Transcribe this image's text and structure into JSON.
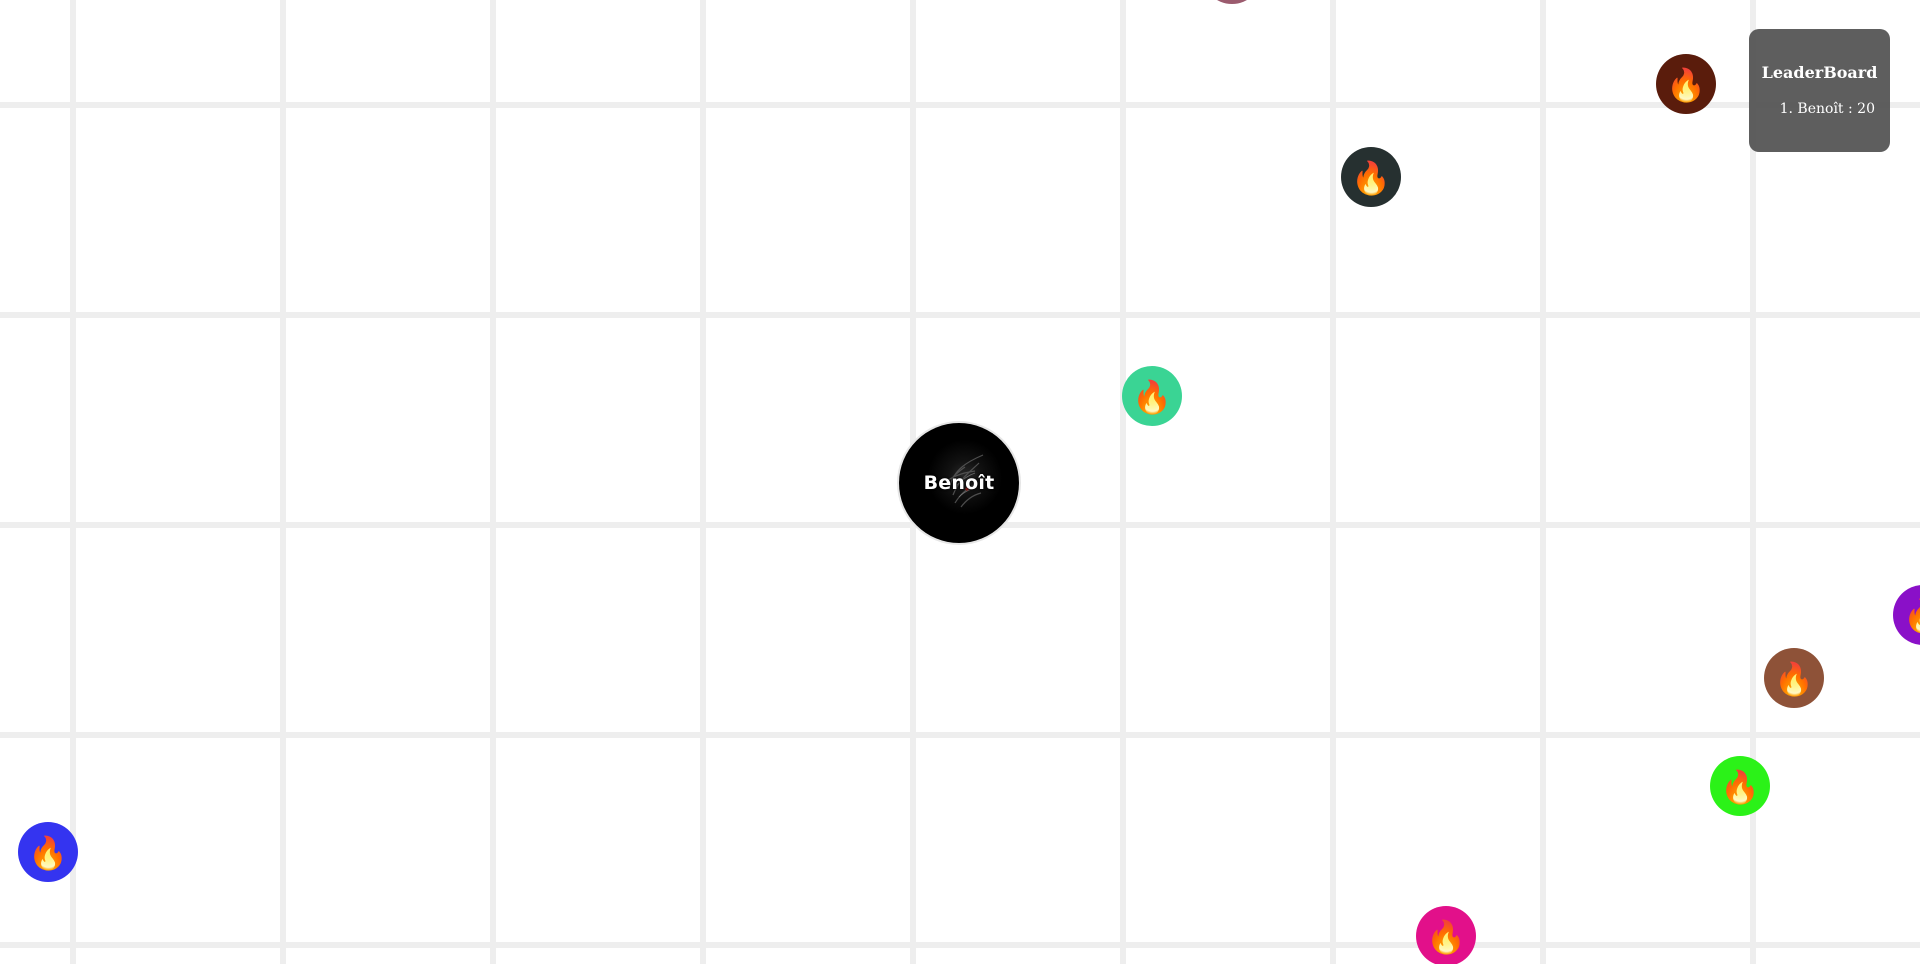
{
  "leaderboard": {
    "title": "LeaderBoard",
    "entries": [
      {
        "rank": "1.",
        "name": "Benoît",
        "separator": ":",
        "score": "20"
      }
    ]
  },
  "player": {
    "name": "Benoît",
    "color": "#000000"
  },
  "food_icon": "fire-emoji",
  "food_glyph": "🔥",
  "food_colors": {
    "top_partial": "#9b5b6e",
    "dark_red": "#5a1c0c",
    "dark_slate": "#263030",
    "teal": "#3ad494",
    "purple": "#8a10c8",
    "brown": "#8e5238",
    "green": "#2bf218",
    "blue": "#3434f0",
    "magenta": "#e2108a"
  },
  "grid_color": "#eeeeee",
  "background_color": "#ffffff"
}
